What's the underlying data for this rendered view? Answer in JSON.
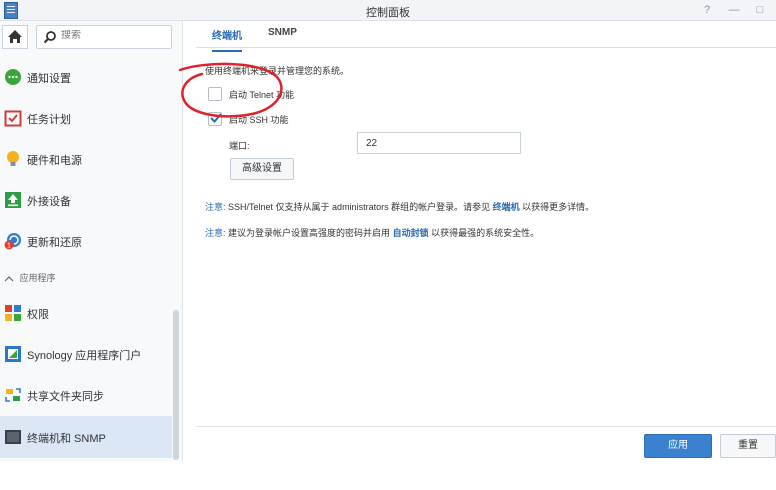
{
  "window": {
    "title": "控制面板",
    "help_icon": "?",
    "min_icon": "—",
    "max_icon": "□"
  },
  "sidebar": {
    "search_placeholder": "搜索",
    "items": [
      {
        "label": "通知设置",
        "icon": "chat-bubble-icon"
      },
      {
        "label": "任务计划",
        "icon": "calendar-check-icon"
      },
      {
        "label": "硬件和电源",
        "icon": "lightbulb-icon"
      },
      {
        "label": "外接设备",
        "icon": "upload-icon"
      },
      {
        "label": "更新和还原",
        "icon": "update-icon"
      }
    ],
    "section_header": "应用程序",
    "app_items": [
      {
        "label": "权限",
        "icon": "grid-icon"
      },
      {
        "label": "Synology 应用程序门户",
        "icon": "portal-icon"
      },
      {
        "label": "共享文件夹同步",
        "icon": "sync-icon"
      },
      {
        "label": "终端机和 SNMP",
        "icon": "terminal-icon",
        "active": true
      }
    ]
  },
  "tabs": [
    {
      "label": "终端机",
      "active": true
    },
    {
      "label": "SNMP",
      "active": false
    }
  ],
  "content": {
    "description": "使用终端机来登录并管理您的系统。",
    "telnet_label": "启动 Telnet 功能",
    "telnet_checked": false,
    "ssh_label": "启动 SSH 功能",
    "ssh_checked": true,
    "port_label": "端口:",
    "port_value": "22",
    "advanced_button": "高级设置",
    "note1_prefix": "注意:",
    "note1_text": "SSH/Telnet 仅支持从属于 administrators 群组的帐户登录。请参见",
    "note1_link": "终端机",
    "note1_suffix": "以获得更多详情。",
    "note2_prefix": "注意:",
    "note2_text": "建议为登录帐户设置高强度的密码并启用",
    "note2_link": "自动封锁",
    "note2_suffix": "以获得最强的系统安全性。"
  },
  "footer": {
    "apply": "应用",
    "reset": "重置"
  },
  "colors": {
    "accent": "#2b6cb3",
    "apply_button": "#3a82cf",
    "annotation_circle": "#e0232a"
  }
}
